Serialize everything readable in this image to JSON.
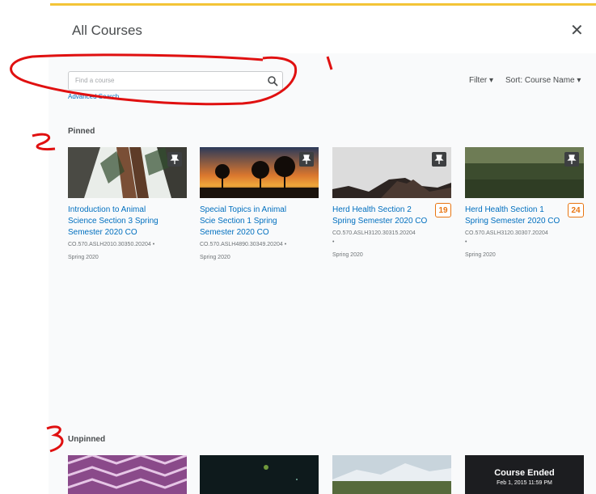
{
  "dialog": {
    "title": "All Courses"
  },
  "search": {
    "placeholder": "Find a course",
    "advanced_label": "Advanced Search"
  },
  "toolbar": {
    "filter_label": "Filter",
    "sort_label": "Sort: Course Name"
  },
  "sections": {
    "pinned": "Pinned",
    "unpinned": "Unpinned"
  },
  "pinned_courses": [
    {
      "name": "Introduction to Animal Science Section 3 Spring Semester 2020 CO",
      "code": "CO.570.ASLH2010.30350.20204",
      "term": "Spring 2020",
      "badge": ""
    },
    {
      "name": "Special Topics in Animal Scie Section 1 Spring Semester 2020 CO",
      "code": "CO.570.ASLH4890.30349.20204",
      "term": "Spring 2020",
      "badge": ""
    },
    {
      "name": "Herd Health Section 2 Spring Semester 2020 CO",
      "code": "CO.570.ASLH3120.30315.20204",
      "term": "Spring 2020",
      "badge": "19"
    },
    {
      "name": "Herd Health Section 1 Spring Semester 2020 CO",
      "code": "CO.570.ASLH3120.30307.20204",
      "term": "Spring 2020",
      "badge": "24"
    }
  ],
  "unpinned_courses": [
    {
      "status": ""
    },
    {
      "status": ""
    },
    {
      "status": ""
    },
    {
      "status": "Course Ended",
      "status_date": "Feb 1, 2015 11:59 PM"
    }
  ],
  "annotations": [
    "1",
    "2",
    "3"
  ],
  "colors": {
    "accent": "#f3c437",
    "link": "#006fbf",
    "badge": "#e87511",
    "annotation": "#e01010"
  }
}
